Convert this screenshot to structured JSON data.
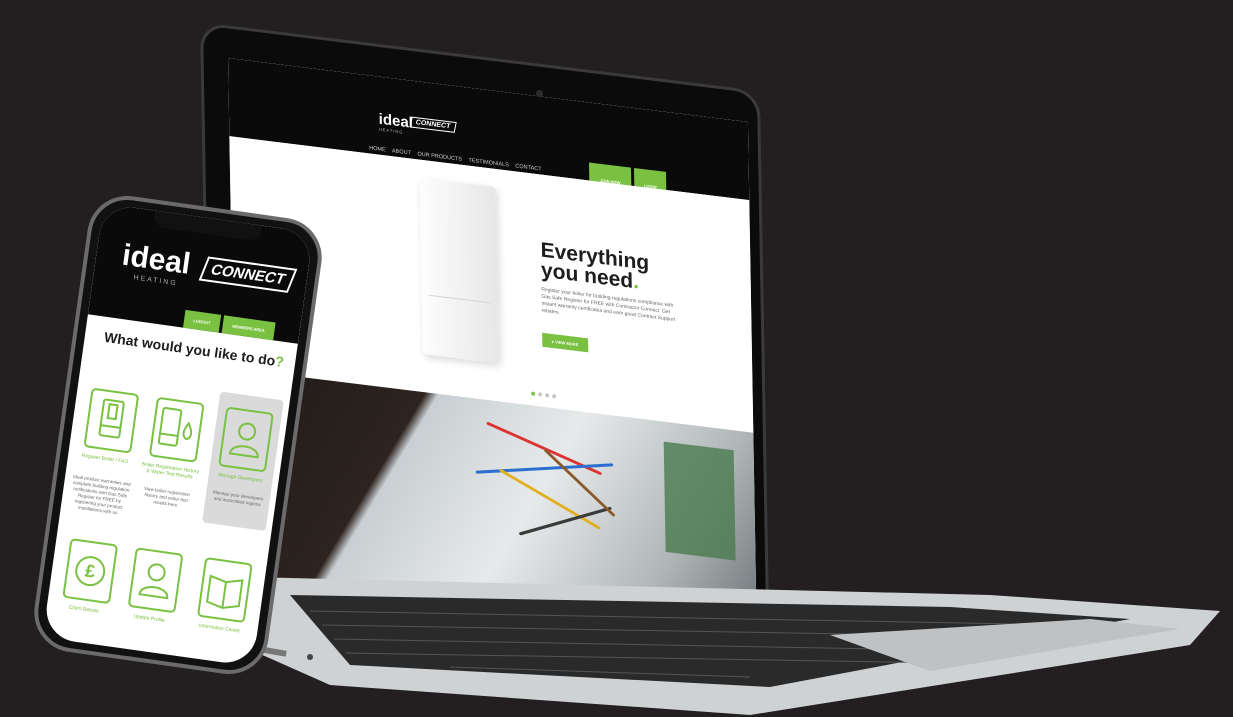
{
  "laptop_site": {
    "logo_text": "ideal",
    "logo_sub": "HEATING",
    "connect_badge": "CONNECT",
    "nav": [
      "HOME",
      "ABOUT",
      "OUR PRODUCTS",
      "TESTIMONIALS",
      "CONTACT"
    ],
    "join_button": "JOIN NOW",
    "login_button": "LOGIN",
    "hero_title_line1": "Everything",
    "hero_title_line2": "you need",
    "hero_title_dot": ".",
    "hero_body": "Register your boiler for building regulations compliance with Gas Safe Register for FREE with Contractor Connect. Get instant warranty certificates and earn great Contract Support rebates.",
    "view_more_button": "▸ VIEW MORE",
    "carousel_dots": 4,
    "carousel_active": 0
  },
  "phone_site": {
    "logo_text": "ideal",
    "logo_sub": "HEATING",
    "connect_badge": "CONNECT",
    "logout_button": "LOGOUT",
    "members_area_button": "MEMBERS AREA",
    "question": "What would you like to do",
    "question_mark": "?",
    "tiles": [
      {
        "label": "Register Boiler / FAO",
        "desc": "Ideal product warranties and complete building regulation notifications with Gas Safe Register for FREE by registering your product installations with us",
        "icon": "boiler-icon"
      },
      {
        "label": "Boiler Registration History & Water Test Results",
        "desc": "View boiler registration history and water test results here",
        "icon": "boiler-water-icon"
      },
      {
        "label": "Manage Developers",
        "desc": "Manage your developers and associated regions",
        "icon": "user-icon"
      },
      {
        "label": "Claim Rebate",
        "desc": "",
        "icon": "pound-icon"
      },
      {
        "label": "Update Profile",
        "desc": "",
        "icon": "profile-icon"
      },
      {
        "label": "Information Centre",
        "desc": "",
        "icon": "book-icon"
      }
    ]
  },
  "colors": {
    "accent": "#7ac142",
    "background": "#231f20",
    "header": "#0a0a0a"
  }
}
